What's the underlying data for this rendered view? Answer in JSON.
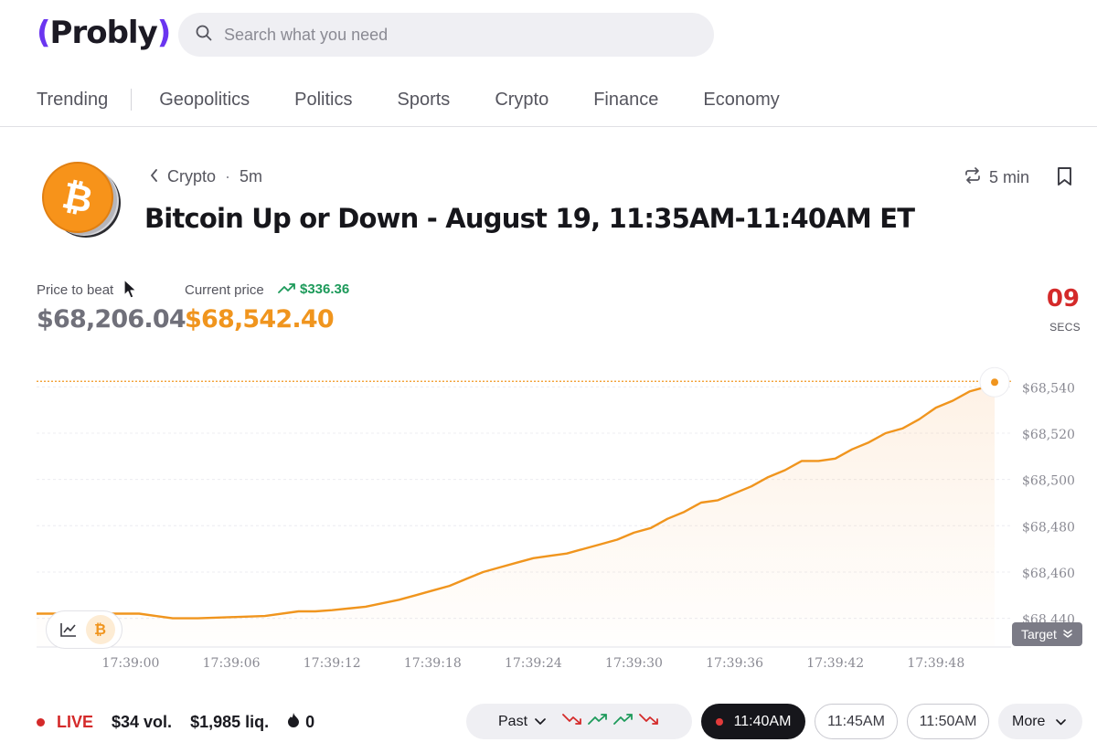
{
  "brand": {
    "name": "Probly",
    "accent": "#6a35f0"
  },
  "search": {
    "placeholder": "Search what you need",
    "icon": "search-icon"
  },
  "nav": {
    "items": [
      "Trending",
      "Geopolitics",
      "Politics",
      "Sports",
      "Crypto",
      "Finance",
      "Economy"
    ]
  },
  "market": {
    "breadcrumb": {
      "category": "Crypto",
      "interval": "5m"
    },
    "title": "Bitcoin Up or Down - August 19, 11:35AM-11:40AM ET",
    "recurrence": "5 min",
    "icon": "bitcoin-icon"
  },
  "prices": {
    "price_to_beat_label": "Price to beat",
    "price_to_beat": "$68,206.04",
    "current_label": "Current price",
    "current": "$68,542.40",
    "delta": "$336.36",
    "colors": {
      "current": "#f0951e",
      "delta": "#1d9a5a",
      "timer": "#d42a2a"
    }
  },
  "timer": {
    "value": "09",
    "unit": "SECS"
  },
  "chart_data": {
    "type": "area",
    "x_ticks": [
      "17:39:00",
      "17:39:06",
      "17:39:12",
      "17:39:18",
      "17:39:24",
      "17:39:30",
      "17:39:36",
      "17:39:42",
      "17:39:48"
    ],
    "y_ticks": [
      "$68,540",
      "$68,520",
      "$68,500",
      "$68,480",
      "$68,460",
      "$68,440"
    ],
    "y_tick_values": [
      68540,
      68520,
      68500,
      68480,
      68460,
      68440
    ],
    "ylim": [
      68428,
      68550
    ],
    "x_range_seconds": [
      -1,
      52
    ],
    "series": [
      {
        "color": "#f0951e",
        "points": [
          [
            -1,
            68442
          ],
          [
            0.5,
            68442
          ],
          [
            1.5,
            68441
          ],
          [
            2.5,
            68440
          ],
          [
            4,
            68440
          ],
          [
            6,
            68440.5
          ],
          [
            8,
            68441
          ],
          [
            10,
            68443
          ],
          [
            11,
            68443
          ],
          [
            12,
            68443.5
          ],
          [
            14,
            68445
          ],
          [
            16,
            68448
          ],
          [
            17,
            68450
          ],
          [
            18,
            68452
          ],
          [
            19,
            68454
          ],
          [
            20,
            68457
          ],
          [
            21,
            68460
          ],
          [
            22,
            68462
          ],
          [
            23,
            68464
          ],
          [
            24,
            68466
          ],
          [
            25,
            68467
          ],
          [
            26,
            68468
          ],
          [
            27,
            68470
          ],
          [
            28,
            68472
          ],
          [
            29,
            68474
          ],
          [
            30,
            68477
          ],
          [
            31,
            68479
          ],
          [
            32,
            68483
          ],
          [
            33,
            68486
          ],
          [
            34,
            68490
          ],
          [
            35,
            68491
          ],
          [
            36,
            68494
          ],
          [
            37,
            68497
          ],
          [
            38,
            68501
          ],
          [
            39,
            68504
          ],
          [
            40,
            68508
          ],
          [
            41,
            68508
          ],
          [
            42,
            68509
          ],
          [
            43,
            68513
          ],
          [
            44,
            68516
          ],
          [
            45,
            68520
          ],
          [
            46,
            68522
          ],
          [
            47,
            68526
          ],
          [
            48,
            68531
          ],
          [
            49,
            68534
          ],
          [
            50,
            68538
          ],
          [
            51,
            68540
          ],
          [
            51.5,
            68542
          ]
        ]
      }
    ],
    "target_line": 68542.4,
    "target_label": "Target",
    "grid": true
  },
  "footer": {
    "live": "LIVE",
    "volume": "$34 vol.",
    "liquidity": "$1,985 liq.",
    "comments": "0",
    "past_label": "Past",
    "past_trend": [
      "down",
      "up",
      "up",
      "down"
    ],
    "slots": [
      "11:40AM",
      "11:45AM",
      "11:50AM"
    ],
    "more_label": "More"
  }
}
